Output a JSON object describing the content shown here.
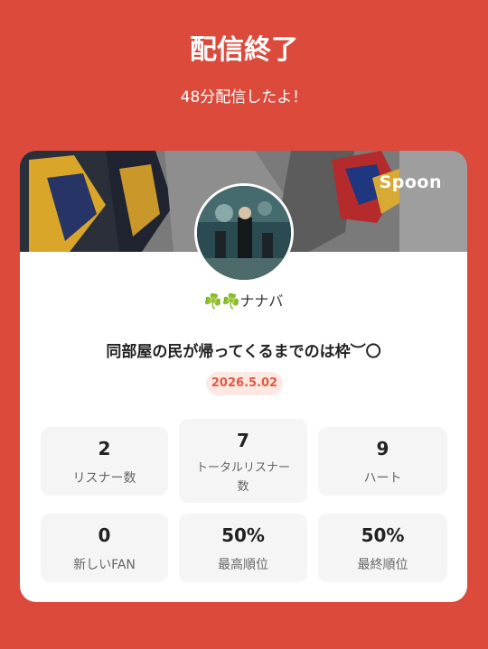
{
  "header": {
    "title": "配信終了",
    "subtitle": "48分配信したよ！"
  },
  "card": {
    "brand": "Spoon",
    "username_icons": "☘️☘️",
    "username": "ナナバ",
    "live_title": "同部屋の民が帰ってくるまでのは枠︶〇",
    "date": "2026.5.02"
  },
  "stats": [
    {
      "value": "2",
      "label": "リスナー数"
    },
    {
      "value": "7",
      "label": "トータルリスナー数"
    },
    {
      "value": "9",
      "label": "ハート"
    },
    {
      "value": "0",
      "label": "新しいFAN"
    },
    {
      "value": "50%",
      "label": "最高順位"
    },
    {
      "value": "50%",
      "label": "最終順位"
    }
  ],
  "colors": {
    "background": "#db4a3b",
    "accent": "#e05a3f",
    "badge_bg": "#fde8e3"
  }
}
